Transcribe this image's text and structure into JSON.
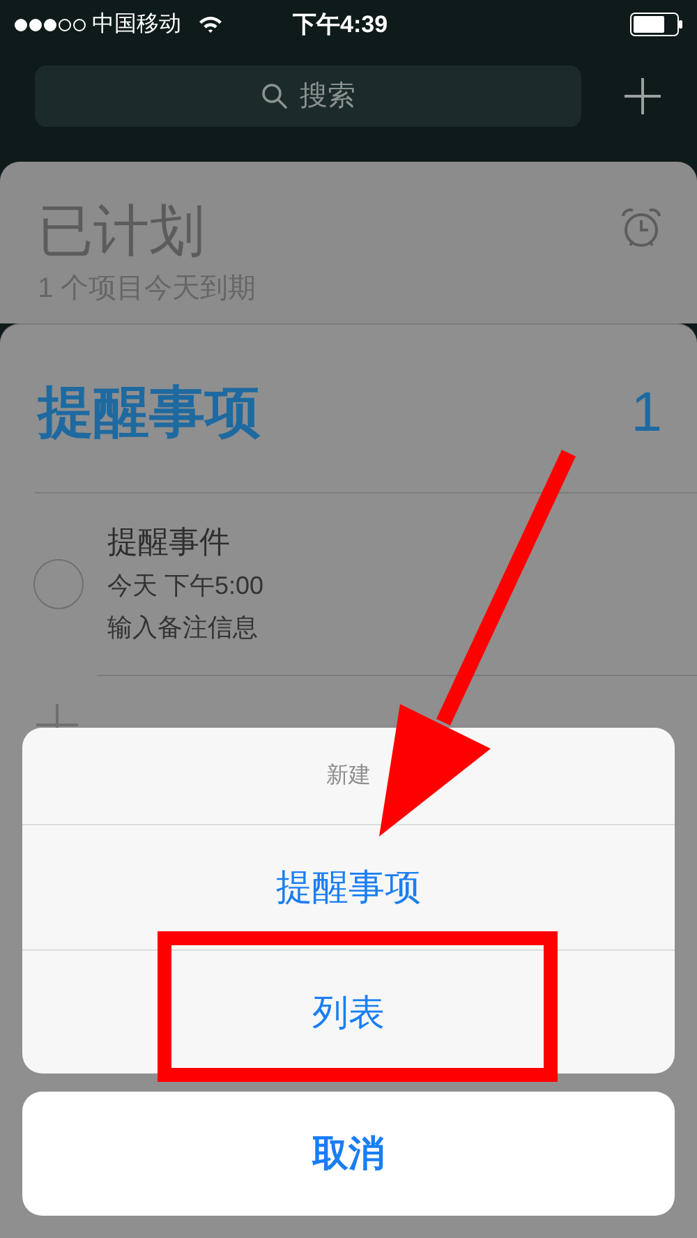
{
  "status_bar": {
    "carrier": "中国移动",
    "time": "下午4:39"
  },
  "search": {
    "placeholder": "搜索"
  },
  "scheduled": {
    "title": "已计划",
    "subtitle": "1 个项目今天到期"
  },
  "list": {
    "title": "提醒事项",
    "count": "1",
    "items": [
      {
        "title": "提醒事件",
        "due": "今天 下午5:00",
        "note": "输入备注信息",
        "checked": false
      }
    ]
  },
  "action_sheet": {
    "title": "新建",
    "actions": [
      "提醒事项",
      "列表"
    ],
    "cancel": "取消"
  }
}
